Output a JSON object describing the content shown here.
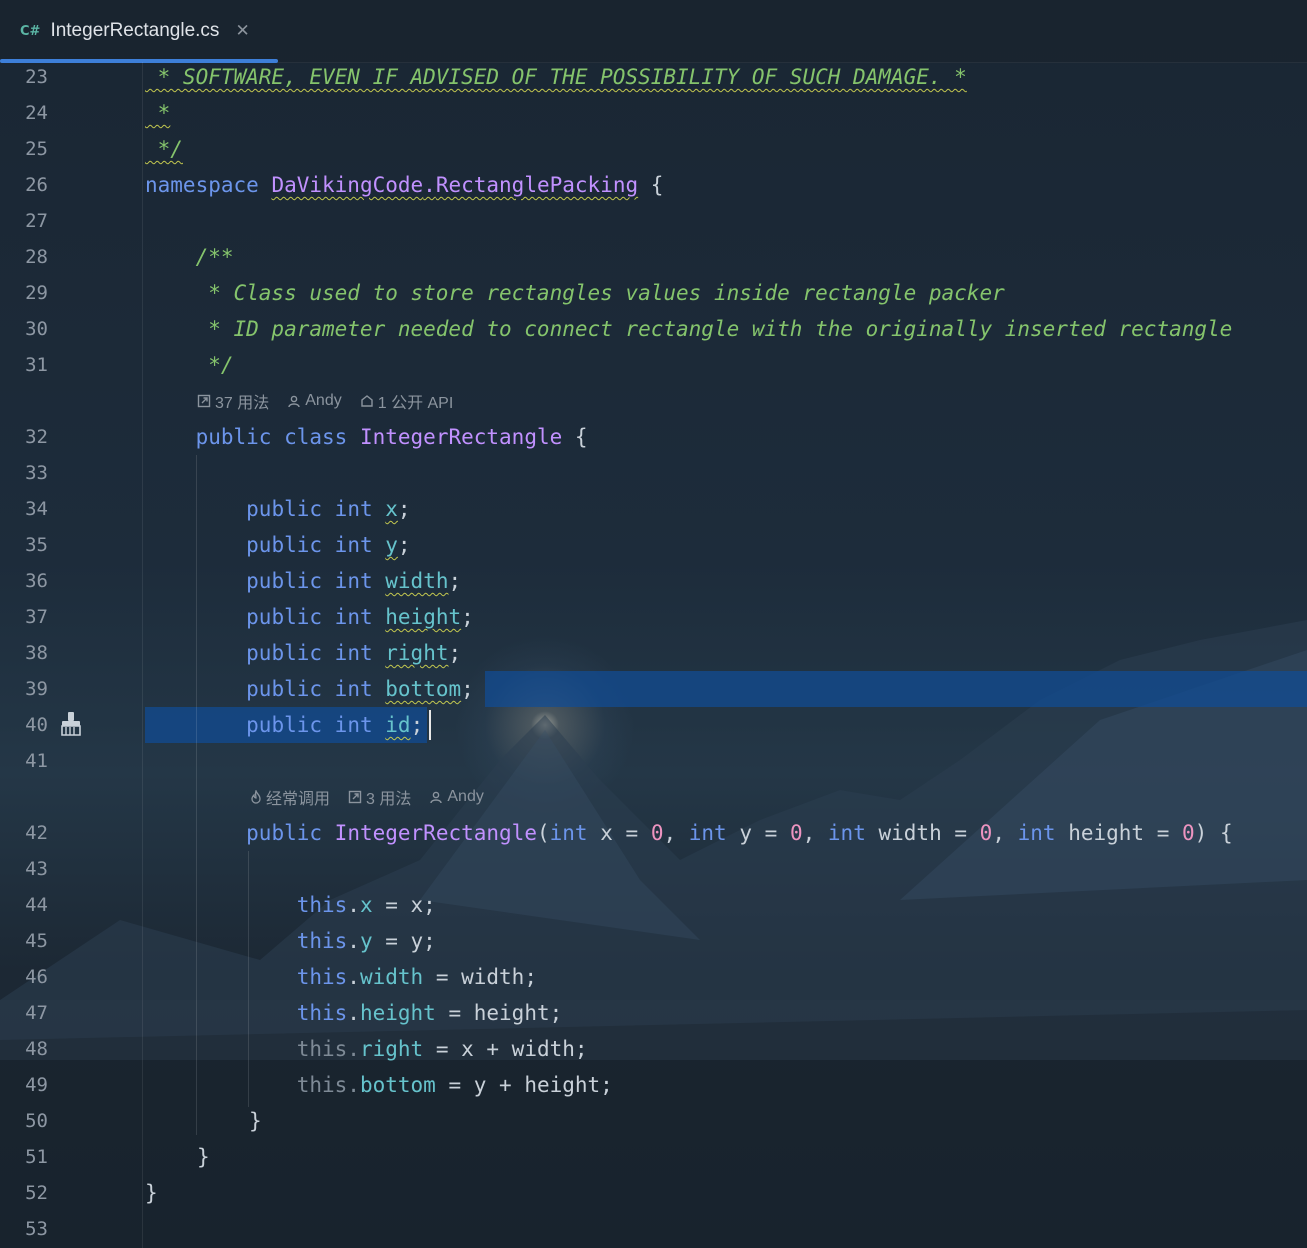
{
  "tab": {
    "lang_badge": "C#",
    "file_name": "IntegerRectangle.cs",
    "close_glyph": "✕"
  },
  "editor": {
    "lines": {
      "l23": {
        "no": "23",
        "text": " * SOFTWARE, EVEN IF ADVISED OF THE POSSIBILITY OF SUCH DAMAGE. *"
      },
      "l24": {
        "no": "24",
        "text": " *"
      },
      "l25": {
        "no": "25",
        "text": " */"
      },
      "l26": {
        "no": "26",
        "kw": "namespace",
        "ns1": "DaVikingCode",
        "dot": ".",
        "ns2": "RectanglePacking",
        "rest": " {"
      },
      "l27": {
        "no": "27"
      },
      "l28": {
        "no": "28",
        "text": "    /**"
      },
      "l29": {
        "no": "29",
        "text": "     * Class used to store rectangles values inside rectangle packer"
      },
      "l30": {
        "no": "30",
        "text": "     * ID parameter needed to connect rectangle with the originally inserted rectangle"
      },
      "l31": {
        "no": "31",
        "text": "     */"
      },
      "l32": {
        "no": "32",
        "kw1": "public",
        "kw2": "class",
        "name": "IntegerRectangle",
        "rest": " {"
      },
      "l33": {
        "no": "33"
      },
      "l34": {
        "no": "34",
        "kw1": "public",
        "kw2": "int",
        "field": "x"
      },
      "l35": {
        "no": "35",
        "kw1": "public",
        "kw2": "int",
        "field": "y"
      },
      "l36": {
        "no": "36",
        "kw1": "public",
        "kw2": "int",
        "field": "width"
      },
      "l37": {
        "no": "37",
        "kw1": "public",
        "kw2": "int",
        "field": "height"
      },
      "l38": {
        "no": "38",
        "kw1": "public",
        "kw2": "int",
        "field": "right"
      },
      "l39": {
        "no": "39",
        "kw1": "public",
        "kw2": "int",
        "field": "bottom"
      },
      "l40": {
        "no": "40",
        "kw1": "public",
        "kw2": "int",
        "field": "id"
      },
      "l41": {
        "no": "41"
      },
      "l42": {
        "no": "42",
        "kw1": "public",
        "name": "IntegerRectangle",
        "p_kw": "int",
        "p1": "x",
        "p2": "y",
        "p3": "width",
        "p4": "height",
        "zero": "0",
        "eq": " = ",
        "comma": ", ",
        "open": "(",
        "close": ") {"
      },
      "l43": {
        "no": "43"
      },
      "l44": {
        "no": "44",
        "this": "this",
        "field": "x",
        "rhs": " = x;"
      },
      "l45": {
        "no": "45",
        "this": "this",
        "field": "y",
        "rhs": " = y;"
      },
      "l46": {
        "no": "46",
        "this": "this",
        "field": "width",
        "rhs": " = width;"
      },
      "l47": {
        "no": "47",
        "this": "this",
        "field": "height",
        "rhs": " = height;"
      },
      "l48": {
        "no": "48",
        "this": "this",
        "field": "right",
        "rhs": " = x + width;"
      },
      "l49": {
        "no": "49",
        "this": "this",
        "field": "bottom",
        "rhs": " = y + height;"
      },
      "l50": {
        "no": "50",
        "text": "}"
      },
      "l51": {
        "no": "51",
        "text": "}"
      },
      "l52": {
        "no": "52",
        "text": "}"
      },
      "l53": {
        "no": "53"
      }
    },
    "hints": {
      "class_hint": {
        "usages": "37 用法",
        "author": "Andy",
        "api": "1 公开 API"
      },
      "ctor_hint": {
        "hot": "经常调用",
        "usages": "3 用法",
        "author": "Andy"
      }
    }
  },
  "colors": {
    "keyword": "#6c95eb",
    "class_name": "#c191ff",
    "field": "#66c3cc",
    "number": "#ed94c0",
    "comment": "#85c46c",
    "selection": "#114c96",
    "tab_accent": "#3d7fd9"
  },
  "icons": [
    "close-icon",
    "usages-icon",
    "author-icon",
    "api-icon",
    "hot-icon",
    "brush-icon"
  ]
}
